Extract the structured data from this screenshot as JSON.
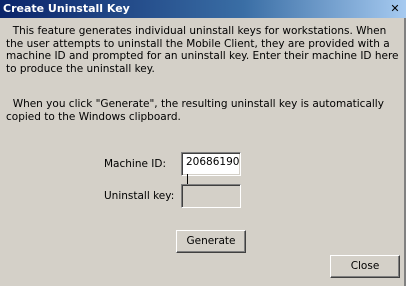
{
  "window": {
    "title": "Create Uninstall Key",
    "close_glyph": "✕"
  },
  "description": {
    "paragraph_1": "This feature generates individual uninstall keys for workstations.  When the user attempts to uninstall the Mobile Client, they are provided with a machine ID and prompted for an uninstall key.  Enter their machine ID here to produce the uninstall key.",
    "paragraph_2": "When you click \"Generate\", the resulting uninstall key is automatically copied to the Windows clipboard."
  },
  "form": {
    "machine_id_label": "Machine ID:",
    "machine_id_value": "20686190",
    "uninstall_key_label": "Uninstall key:",
    "uninstall_key_value": ""
  },
  "buttons": {
    "generate_label": "Generate",
    "close_label": "Close"
  },
  "colors": {
    "title_bar_start": "#0a246a",
    "title_bar_end": "#a6caf0",
    "dialog_background": "#d4d0c8"
  }
}
